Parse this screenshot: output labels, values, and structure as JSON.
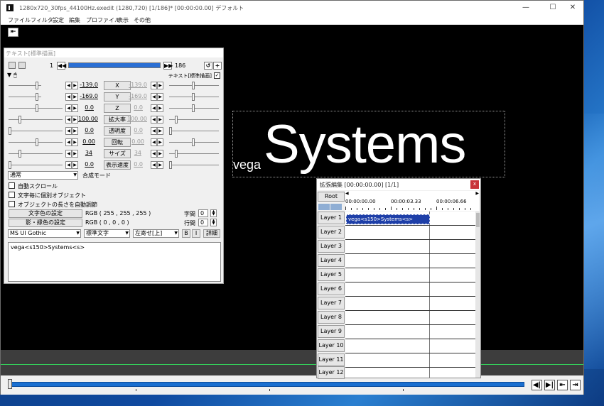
{
  "window": {
    "title": "1280x720_30fps_44100Hz.exedit (1280,720)  [1/186]* [00:00:00.00] デフォルト",
    "minimize": "—",
    "maximize": "☐",
    "close": "✕"
  },
  "menu": [
    "ファイル",
    "フィルタ",
    "設定",
    "編集",
    "プロファイル",
    "表示",
    "その他"
  ],
  "back_button": "⇤",
  "preview": {
    "small_text": "vega",
    "big_text": "Systems"
  },
  "text_panel": {
    "title": "テキスト[標準描画]",
    "frame_current": "1",
    "frame_total": "186",
    "filter_label": "テキスト[標準描画]",
    "filter_checked": "✓",
    "params": [
      {
        "left": "-139.0",
        "label": "X",
        "right": "-139.0"
      },
      {
        "left": "-169.0",
        "label": "Y",
        "right": "-169.0"
      },
      {
        "left": "0.0",
        "label": "Z",
        "right": "0.0"
      },
      {
        "left": "100.00",
        "label": "拡大率",
        "right": "100.00"
      },
      {
        "left": "0.0",
        "label": "透明度",
        "right": "0.0"
      },
      {
        "left": "0.00",
        "label": "回転",
        "right": "0.00"
      },
      {
        "left": "34",
        "label": "サイズ",
        "right": "34"
      },
      {
        "left": "0.0",
        "label": "表示速度",
        "right": "0.0"
      }
    ],
    "blend_select": "通常",
    "blend_label": "合成モード",
    "auto_scroll": "自動スクロール",
    "per_char_object": "文字毎に個別オブジェクト",
    "auto_length": "オブジェクトの長さを自動調節",
    "text_color_button": "文字色の設定",
    "text_color_value": "RGB ( 255 , 255 , 255 )",
    "shadow_color_button": "影・縁色の設定",
    "shadow_color_value": "RGB ( 0 , 0 , 0 )",
    "char_spacing_label": "字間",
    "char_spacing_value": "0",
    "line_spacing_label": "行間",
    "line_spacing_value": "0",
    "font_select": "MS UI Gothic",
    "style_select": "標準文字",
    "align_select": "左寄せ[上]",
    "bold": "B",
    "italic": "I",
    "details": "詳細",
    "text_content": "vega<s150>Systems<s>"
  },
  "ext_edit": {
    "title": "拡張編集 [00:00:00.00] [1/1]",
    "close": "x",
    "root": "Root",
    "ruler_labels": [
      "00:00:00.00",
      "00:00:03.33",
      "00:00:06.66"
    ],
    "layers": [
      "Layer 1",
      "Layer 2",
      "Layer 3",
      "Layer 4",
      "Layer 5",
      "Layer 6",
      "Layer 7",
      "Layer 8",
      "Layer 9",
      "Layer 10",
      "Layer 11",
      "Layer 12"
    ],
    "clip_text": "vega<s150>Systems<s>"
  },
  "playback": {
    "play": "◀|",
    "pause": "▶|",
    "prev": "⇤",
    "next": "⇥"
  }
}
